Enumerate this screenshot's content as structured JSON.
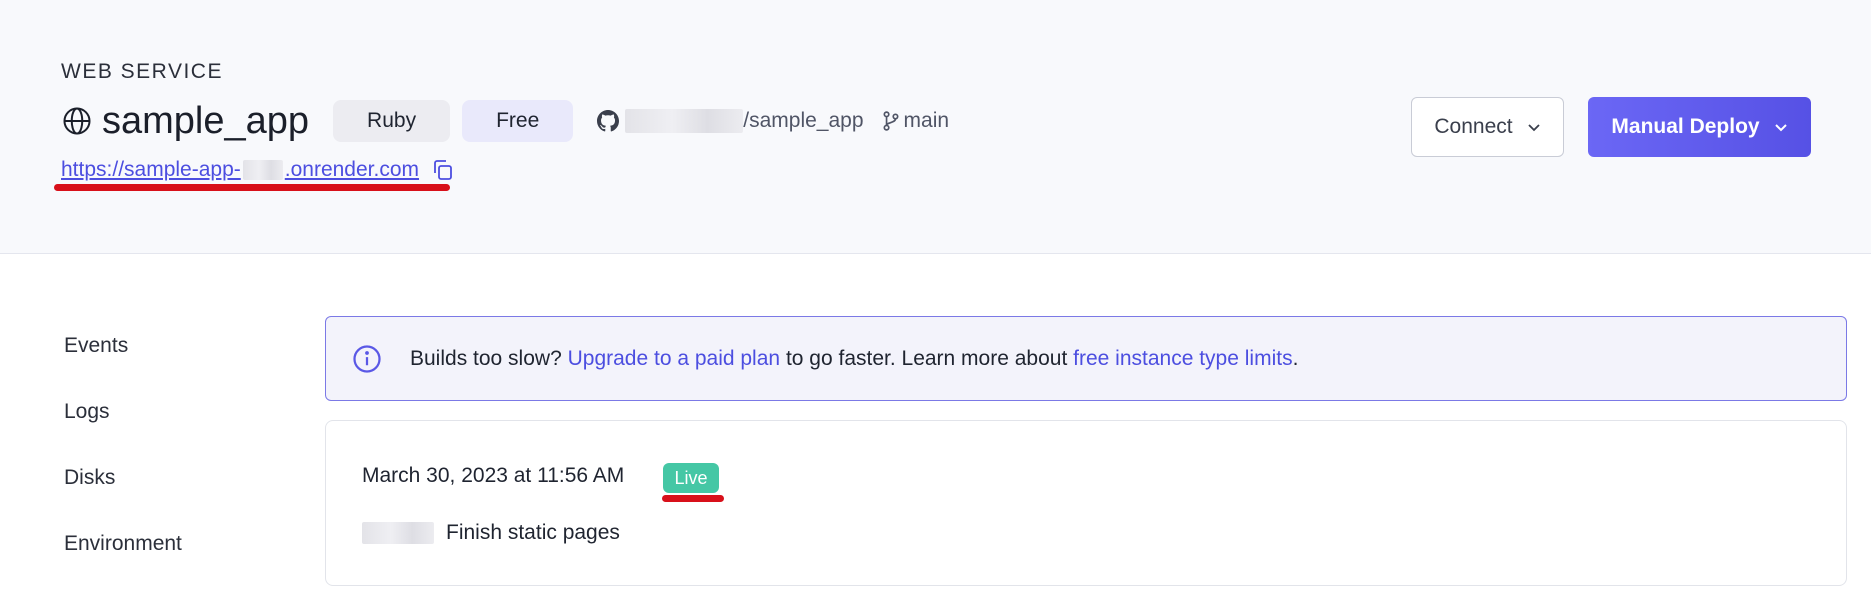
{
  "header": {
    "kind": "WEB SERVICE",
    "service_name": "sample_app",
    "runtime_tag": "Ruby",
    "plan_tag": "Free",
    "repo_suffix": "/sample_app",
    "branch": "main",
    "url_prefix": "https://sample-app-",
    "url_suffix": ".onrender.com"
  },
  "actions": {
    "connect_label": "Connect",
    "deploy_label": "Manual Deploy"
  },
  "nav": {
    "items": [
      {
        "label": "Events"
      },
      {
        "label": "Logs"
      },
      {
        "label": "Disks"
      },
      {
        "label": "Environment"
      }
    ]
  },
  "banner": {
    "lead": "Builds too slow?",
    "link1": "Upgrade to a paid plan",
    "middle": "to go faster. Learn more about",
    "link2": "free instance type limits",
    "end": "."
  },
  "deploy": {
    "timestamp": "March 30, 2023 at 11:56 AM",
    "status": "Live",
    "commit_message": "Finish static pages"
  },
  "colors": {
    "accent": "#4c4ee0",
    "deploy_button": "#5f5bee",
    "live_badge": "#45c7a5",
    "annotation_red": "#d8101a"
  }
}
